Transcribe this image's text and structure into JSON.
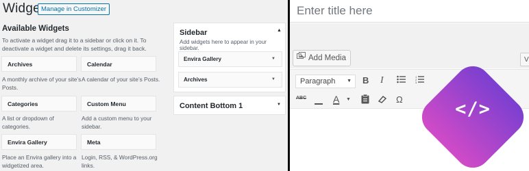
{
  "widgets": {
    "title": "Widgets",
    "manage_button": "Manage in Customizer",
    "available_title": "Available Widgets",
    "available_desc": "To activate a widget drag it to a sidebar or click on it. To deactivate a widget and delete its settings, drag it back.",
    "items": [
      {
        "label": "Archives",
        "desc": "A monthly archive of your site’s Posts."
      },
      {
        "label": "Calendar",
        "desc": "A calendar of your site’s Posts."
      },
      {
        "label": "Categories",
        "desc": "A list or dropdown of categories."
      },
      {
        "label": "Custom Menu",
        "desc": "Add a custom menu to your sidebar."
      },
      {
        "label": "Envira Gallery",
        "desc": "Place an Envira gallery into a widgetized area."
      },
      {
        "label": "Meta",
        "desc": "Login, RSS, & WordPress.org links."
      }
    ],
    "sidebar": {
      "title": "Sidebar",
      "desc": "Add widgets here to appear in your sidebar.",
      "widgets": [
        "Envira Gallery",
        "Archives"
      ]
    },
    "content_bottom": {
      "title": "Content Bottom 1"
    }
  },
  "editor": {
    "title_placeholder": "Enter title here",
    "add_media_label": "Add Media",
    "view_tab_label": "V",
    "format_select": "Paragraph",
    "toolbar_icons": [
      "bold-icon",
      "italic-icon",
      "bullet-list-icon",
      "numbered-list-icon",
      "strikethrough-icon",
      "horizontal-rule-icon",
      "text-color-icon",
      "paste-text-icon",
      "clear-formatting-icon",
      "special-character-icon"
    ],
    "strike_label": "ABC",
    "bold_label": "B",
    "italic_label": "I",
    "text_color_label": "A",
    "special_char_label": "Ω"
  },
  "badge": {
    "label": "</>",
    "color_top": "#7b3fd0",
    "color_bottom": "#d14bc7"
  }
}
